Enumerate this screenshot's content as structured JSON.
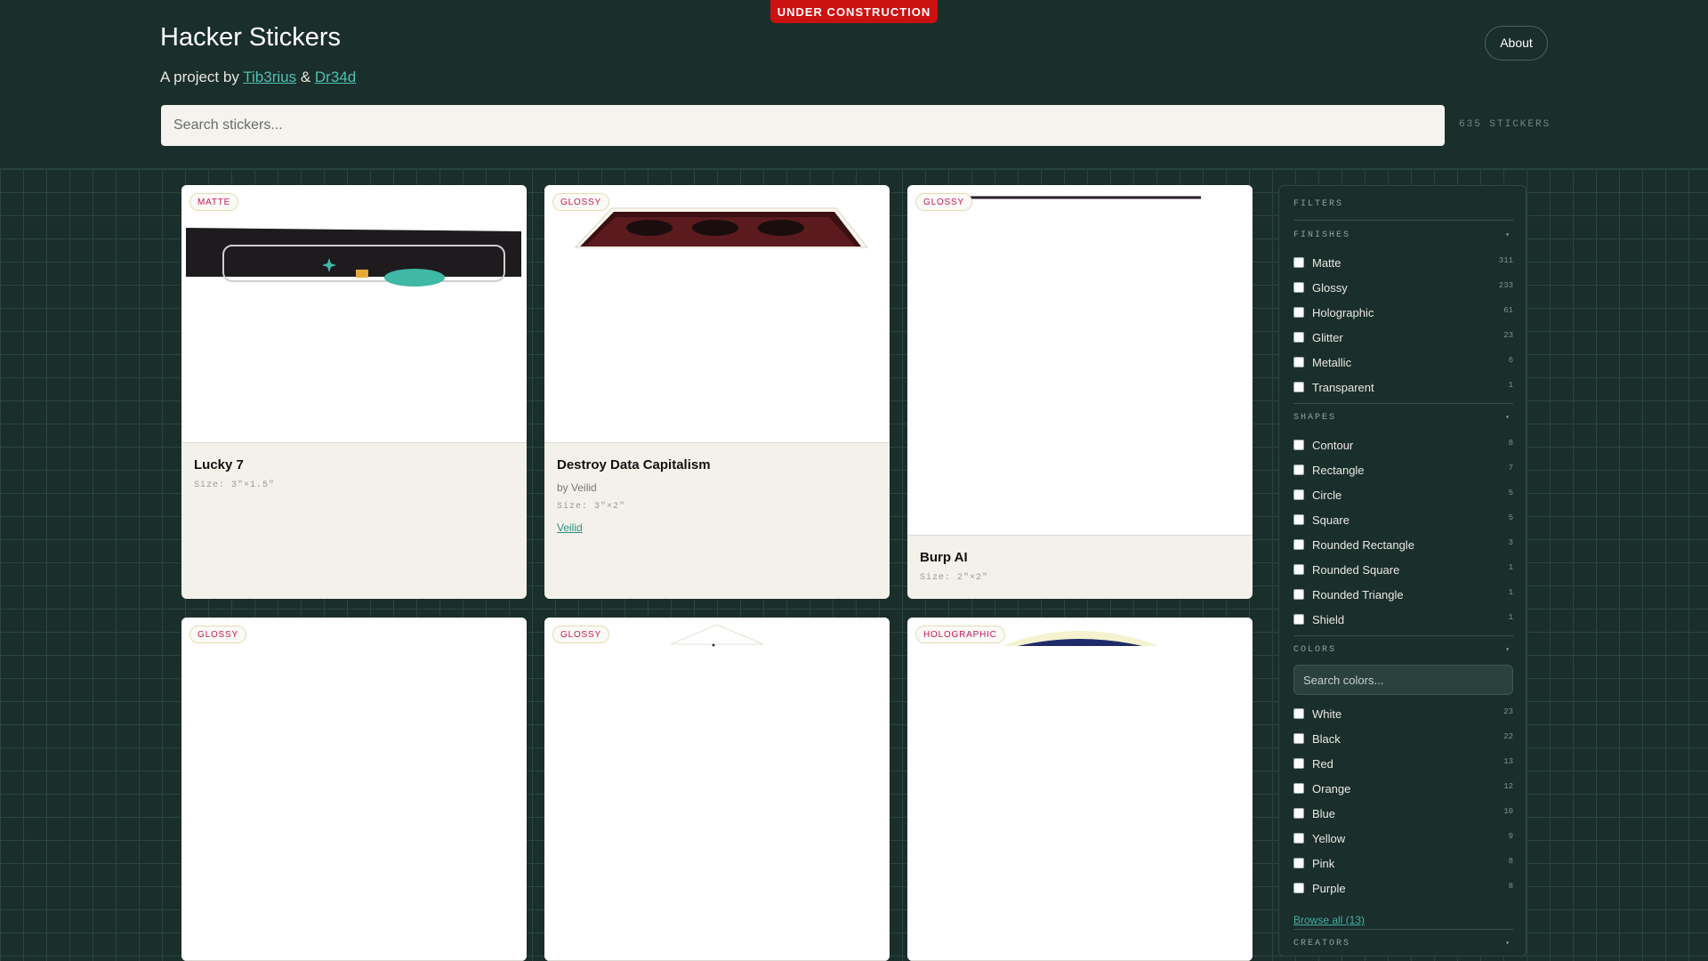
{
  "banner": "UNDER CONSTRUCTION",
  "header": {
    "title": "Hacker Stickers",
    "byline_prefix": "A project by",
    "author1": "Tib3rius",
    "amp": "&",
    "author2": "Dr34d",
    "about_label": "About",
    "search_placeholder": "Search stickers...",
    "count": "635 STICKERS"
  },
  "cards": [
    {
      "badge": "MATTE",
      "title": "Lucky 7",
      "size": "Size: 3\"×1.5\""
    },
    {
      "badge": "GLOSSY",
      "title": "Destroy Data Capitalism",
      "by": "by Veilid",
      "size": "Size: 3\"×2\"",
      "link": "Veilid"
    },
    {
      "badge": "GLOSSY",
      "title": "Burp AI",
      "size": "Size: 2\"×2\""
    },
    {
      "badge": "GLOSSY"
    },
    {
      "badge": "GLOSSY"
    },
    {
      "badge": "HOLOGRAPHIC"
    }
  ],
  "sidebar": {
    "title": "FILTERS",
    "finishes": {
      "label": "FINISHES",
      "items": [
        {
          "label": "Matte",
          "count": "311"
        },
        {
          "label": "Glossy",
          "count": "233"
        },
        {
          "label": "Holographic",
          "count": "61"
        },
        {
          "label": "Glitter",
          "count": "23"
        },
        {
          "label": "Metallic",
          "count": "6"
        },
        {
          "label": "Transparent",
          "count": "1"
        }
      ]
    },
    "shapes": {
      "label": "SHAPES",
      "items": [
        {
          "label": "Contour",
          "count": "8"
        },
        {
          "label": "Rectangle",
          "count": "7"
        },
        {
          "label": "Circle",
          "count": "5"
        },
        {
          "label": "Square",
          "count": "5"
        },
        {
          "label": "Rounded Rectangle",
          "count": "3"
        },
        {
          "label": "Rounded Square",
          "count": "1"
        },
        {
          "label": "Rounded Triangle",
          "count": "1"
        },
        {
          "label": "Shield",
          "count": "1"
        }
      ]
    },
    "colors": {
      "label": "COLORS",
      "search_placeholder": "Search colors...",
      "items": [
        {
          "label": "White",
          "count": "23"
        },
        {
          "label": "Black",
          "count": "22"
        },
        {
          "label": "Red",
          "count": "13"
        },
        {
          "label": "Orange",
          "count": "12"
        },
        {
          "label": "Blue",
          "count": "10"
        },
        {
          "label": "Yellow",
          "count": "9"
        },
        {
          "label": "Pink",
          "count": "8"
        },
        {
          "label": "Purple",
          "count": "8"
        }
      ],
      "browse_all": "Browse all (13)"
    },
    "creators": {
      "label": "CREATORS"
    }
  }
}
